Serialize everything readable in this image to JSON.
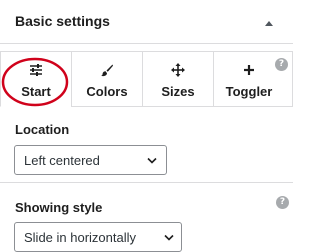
{
  "panel": {
    "title": "Basic settings",
    "toggle_icon": "triangle-up-icon"
  },
  "tabs": [
    {
      "label": "Start",
      "icon": "sliders-icon",
      "active": true
    },
    {
      "label": "Colors",
      "icon": "paintbrush-icon",
      "active": false
    },
    {
      "label": "Sizes",
      "icon": "move-arrows-icon",
      "active": false
    },
    {
      "label": "Toggler",
      "icon": "plus-icon",
      "active": false
    }
  ],
  "help": {
    "symbol": "?"
  },
  "location": {
    "label": "Location",
    "selected": "Left centered"
  },
  "showing_style": {
    "label": "Showing style",
    "selected": "Slide in horizontally"
  },
  "colors": {
    "highlight": "#d0021b",
    "help_badge": "#a7aaad",
    "border": "#dcdcde"
  }
}
